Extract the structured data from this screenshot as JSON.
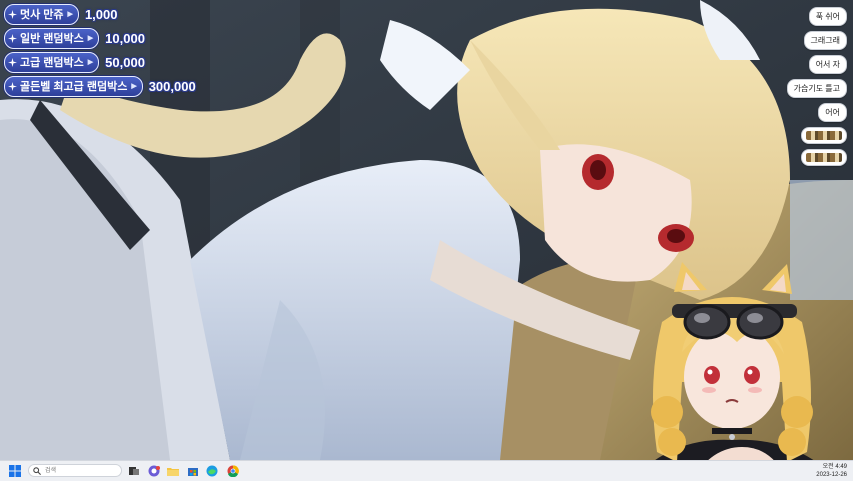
{
  "price_list": [
    {
      "label": "멋사 만쥬",
      "value": "1,000"
    },
    {
      "label": "일반 랜덤박스",
      "value": "10,000"
    },
    {
      "label": "고급 랜덤박스",
      "value": "50,000"
    },
    {
      "label": "골든벨 최고급 랜덤박스",
      "value": "300,000"
    }
  ],
  "chat_messages": [
    "푹 쉬어",
    "그래그래",
    "어서 자",
    "가습기도 틀고",
    "어어"
  ],
  "emote_messages": 2,
  "taskbar": {
    "search_placeholder": "검색",
    "icons": [
      "windows-start-icon",
      "search-icon",
      "task-view-icon",
      "chat-app-icon",
      "file-explorer-icon",
      "store-icon",
      "edge-icon",
      "chrome-icon"
    ],
    "clock_time": "오전 4:49",
    "clock_date": "2023-12-26"
  },
  "colors": {
    "pill_top": "#4b63c8",
    "pill_bottom": "#2e3f9a",
    "taskbar": "#eef0f4"
  }
}
